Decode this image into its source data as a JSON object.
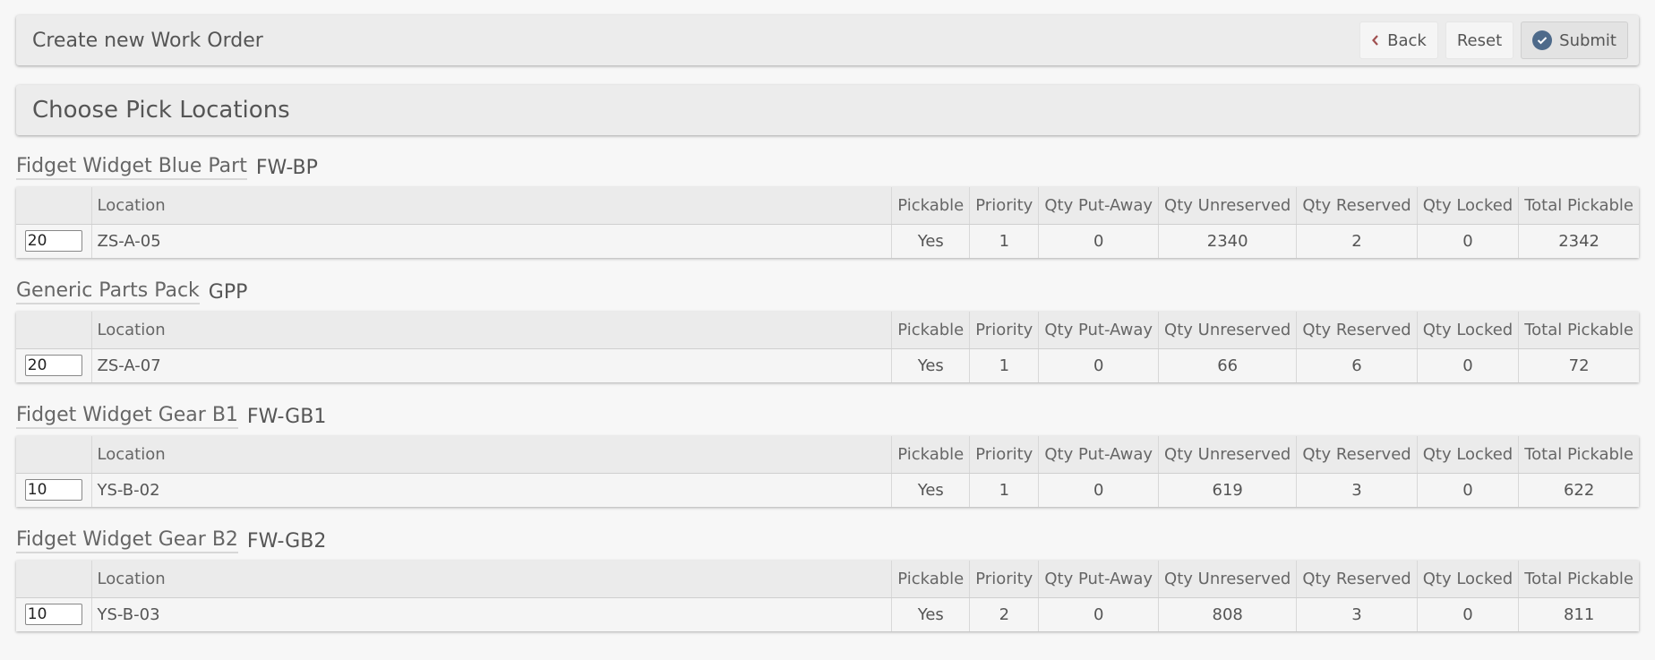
{
  "header": {
    "title": "Create new Work Order",
    "back_label": "Back",
    "reset_label": "Reset",
    "submit_label": "Submit"
  },
  "section": {
    "title": "Choose Pick Locations"
  },
  "columns": {
    "location": "Location",
    "pickable": "Pickable",
    "priority": "Priority",
    "qty_put_away": "Qty Put-Away",
    "qty_unreserved": "Qty Unreserved",
    "qty_reserved": "Qty Reserved",
    "qty_locked": "Qty Locked",
    "total_pickable": "Total Pickable"
  },
  "parts": [
    {
      "name": "Fidget Widget Blue Part",
      "code": "FW-BP",
      "row": {
        "qty": "20",
        "location": "ZS-A-05",
        "pickable": "Yes",
        "priority": "1",
        "qty_put_away": "0",
        "qty_unreserved": "2340",
        "qty_reserved": "2",
        "qty_locked": "0",
        "total_pickable": "2342"
      }
    },
    {
      "name": "Generic Parts Pack",
      "code": "GPP",
      "row": {
        "qty": "20",
        "location": "ZS-A-07",
        "pickable": "Yes",
        "priority": "1",
        "qty_put_away": "0",
        "qty_unreserved": "66",
        "qty_reserved": "6",
        "qty_locked": "0",
        "total_pickable": "72"
      }
    },
    {
      "name": "Fidget Widget Gear B1",
      "code": "FW-GB1",
      "row": {
        "qty": "10",
        "location": "YS-B-02",
        "pickable": "Yes",
        "priority": "1",
        "qty_put_away": "0",
        "qty_unreserved": "619",
        "qty_reserved": "3",
        "qty_locked": "0",
        "total_pickable": "622"
      }
    },
    {
      "name": "Fidget Widget Gear B2",
      "code": "FW-GB2",
      "row": {
        "qty": "10",
        "location": "YS-B-03",
        "pickable": "Yes",
        "priority": "2",
        "qty_put_away": "0",
        "qty_unreserved": "808",
        "qty_reserved": "3",
        "qty_locked": "0",
        "total_pickable": "811"
      }
    }
  ],
  "icons": {
    "back": "chevron-left-icon",
    "submit": "check-circle-icon"
  },
  "colors": {
    "submit_icon": "#4e6a8a",
    "back_chevron": "#a05050"
  }
}
